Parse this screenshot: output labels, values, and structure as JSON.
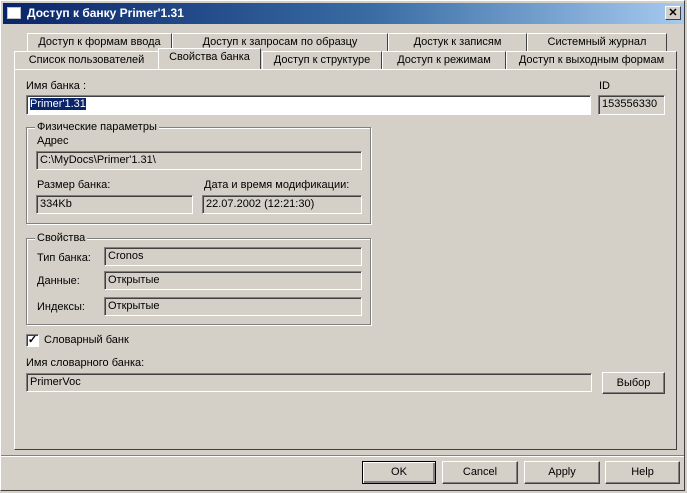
{
  "window": {
    "title": "Доступ к банку Primer'1.31",
    "close_label": "✕"
  },
  "tabs_top": [
    {
      "label": "Доступ к формам ввода"
    },
    {
      "label": "Доступ к запросам по образцу"
    },
    {
      "label": "Достук к записям"
    },
    {
      "label": "Системный журнал"
    }
  ],
  "tabs_bottom": [
    {
      "label": "Список пользователей"
    },
    {
      "label": "Свойства банка",
      "active": true
    },
    {
      "label": "Доступ к структуре"
    },
    {
      "label": "Доступ к режимам"
    },
    {
      "label": "Доступ к выходным формам"
    }
  ],
  "bank": {
    "name_label": "Имя банка :",
    "name_value": "Primer'1.31",
    "id_label": "ID",
    "id_value": "153556330"
  },
  "physical": {
    "group_title": "Физические параметры",
    "address_label": "Адрес",
    "address_value": "C:\\MyDocs\\Primer'1.31\\",
    "size_label": "Размер банка:",
    "size_value": "334Kb",
    "modified_label": "Дата и время модификации:",
    "modified_value": "22.07.2002 (12:21:30)"
  },
  "properties": {
    "group_title": "Свойства",
    "type_label": "Тип банка:",
    "type_value": "Cronos",
    "data_label": "Данные:",
    "data_value": "Открытые",
    "index_label": "Индексы:",
    "index_value": "Открытые"
  },
  "dictionary": {
    "checkbox_label": "Словарный банк",
    "checked": true,
    "name_label": "Имя словарного банка:",
    "name_value": "PrimerVoc",
    "choose_label": "Выбор"
  },
  "buttons": {
    "ok": "OK",
    "cancel": "Cancel",
    "apply": "Apply",
    "help": "Help"
  }
}
